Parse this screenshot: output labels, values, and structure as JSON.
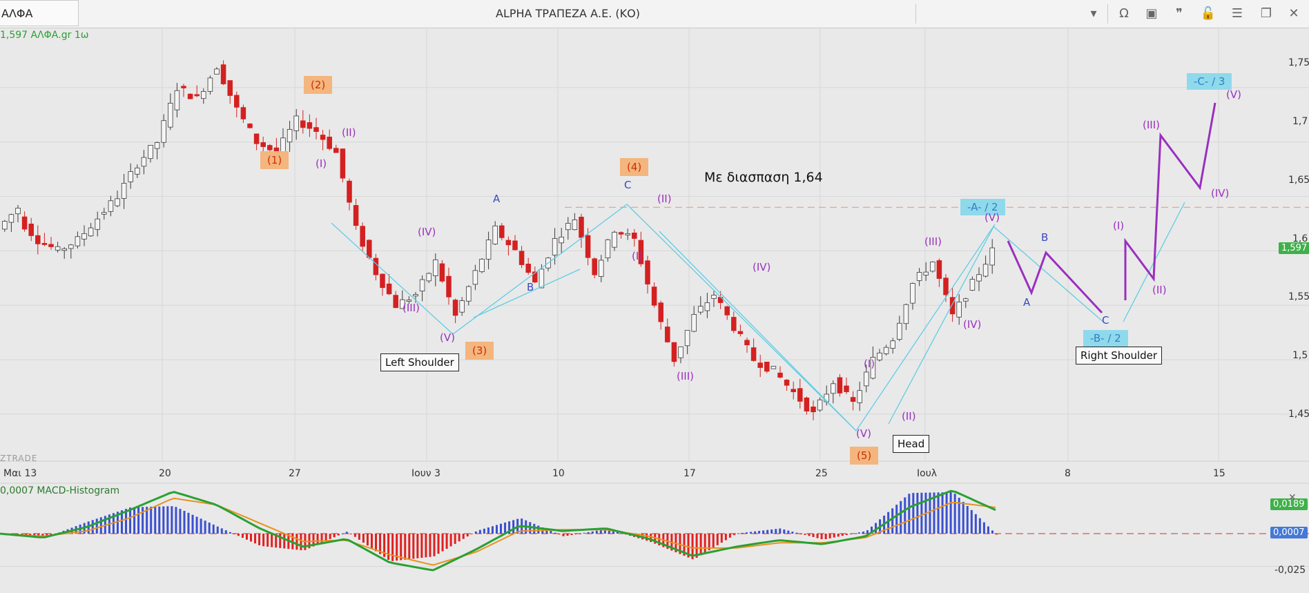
{
  "window": {
    "symbol": "ΑΛΦΑ",
    "title": "ALPHA ΤΡΑΠΕΖΑ Α.Ε. (ΚΟ)",
    "icons": [
      "chevron-down-icon",
      "omega-icon",
      "panel-icon",
      "comment-icon",
      "unlock-icon",
      "menu-icon",
      "restore-icon",
      "close-icon"
    ],
    "icon_glyphs": [
      "▾",
      "Ω",
      "▣",
      "❞",
      "🔓",
      "☰",
      "❐",
      "✕"
    ]
  },
  "price_info": "1,597 ΑΛΦΑ.gr 1ω",
  "watermark": "ZTRADE",
  "macd_info": "0,0007 MACD-Histogram",
  "annotation_title": "Με διασπαση 1,64",
  "labels": {
    "left_shoulder": "Left Shoulder",
    "head": "Head",
    "right_shoulder": "Right Shoulder",
    "w1": "(1)",
    "w2": "(2)",
    "w3": "(3)",
    "w4": "(4)",
    "w5": "(5)",
    "a2": "-A- / 2",
    "b2": "-B- / 2",
    "c3": "-C- / 3",
    "A": "A",
    "B": "B",
    "C": "C",
    "I": "(I)",
    "II": "(II)",
    "III": "(III)",
    "IV": "(IV)",
    "V": "(V)"
  },
  "colors": {
    "up": "#3a3a3a",
    "down": "#d42020",
    "green": "#2aa033",
    "purple": "#9a2fbf",
    "cyan": "#5fcde4",
    "orange": "#e8921c",
    "macd_pos": "#3a4fd0",
    "macd_neg": "#e02020"
  },
  "current_price": "1,597",
  "macd_values": {
    "line": "0,0189",
    "hist": "0,0007"
  },
  "chart_data": [
    {
      "type": "candlestick",
      "title": "ALPHA ΤΡΑΠΕΖΑ Α.Ε. (ΚΟ)",
      "y_ticks": [
        "1,75",
        "1,7",
        "1,65",
        "1,6",
        "1,55",
        "1,5",
        "1,45"
      ],
      "y_tick_values": [
        1.75,
        1.7,
        1.65,
        1.6,
        1.55,
        1.5,
        1.45
      ],
      "x_ticks": [
        "Μαι 13",
        "20",
        "27",
        "Ιουν 3",
        "10",
        "17",
        "25",
        "Ιουλ",
        "8",
        "15"
      ],
      "ylim": [
        1.41,
        1.8
      ],
      "resistance": 1.64,
      "close_path": [
        [
          1.62,
          1.64
        ],
        [
          1.63,
          1.61
        ],
        [
          1.61,
          1.6
        ],
        [
          1.6,
          1.61
        ],
        [
          1.61,
          1.63
        ],
        [
          1.63,
          1.65
        ],
        [
          1.65,
          1.68
        ],
        [
          1.68,
          1.7
        ],
        [
          1.7,
          1.75
        ],
        [
          1.75,
          1.74
        ],
        [
          1.74,
          1.77
        ],
        [
          1.77,
          1.73
        ],
        [
          1.73,
          1.7
        ],
        [
          1.7,
          1.69
        ],
        [
          1.69,
          1.72
        ],
        [
          1.72,
          1.71
        ],
        [
          1.71,
          1.69
        ],
        [
          1.69,
          1.62
        ],
        [
          1.62,
          1.58
        ],
        [
          1.58,
          1.55
        ],
        [
          1.55,
          1.56
        ],
        [
          1.56,
          1.59
        ],
        [
          1.59,
          1.54
        ],
        [
          1.54,
          1.58
        ],
        [
          1.58,
          1.62
        ],
        [
          1.62,
          1.6
        ],
        [
          1.6,
          1.57
        ],
        [
          1.57,
          1.61
        ],
        [
          1.61,
          1.63
        ],
        [
          1.63,
          1.58
        ],
        [
          1.58,
          1.62
        ],
        [
          1.62,
          1.61
        ],
        [
          1.61,
          1.55
        ],
        [
          1.55,
          1.5
        ],
        [
          1.5,
          1.54
        ],
        [
          1.54,
          1.56
        ],
        [
          1.56,
          1.53
        ],
        [
          1.53,
          1.5
        ],
        [
          1.5,
          1.49
        ],
        [
          1.49,
          1.47
        ],
        [
          1.47,
          1.45
        ],
        [
          1.45,
          1.48
        ],
        [
          1.48,
          1.46
        ],
        [
          1.46,
          1.5
        ],
        [
          1.5,
          1.52
        ],
        [
          1.52,
          1.57
        ],
        [
          1.57,
          1.59
        ],
        [
          1.59,
          1.54
        ],
        [
          1.54,
          1.57
        ],
        [
          1.57,
          1.6
        ]
      ],
      "projection": {
        "points": [
          [
            1.6,
            1.55
          ],
          [
            1.55,
            1.59
          ],
          [
            1.59,
            1.53
          ],
          [
            1.53,
            1.6
          ],
          [
            1.6,
            1.57
          ],
          [
            1.57,
            1.69
          ],
          [
            1.69,
            1.65
          ],
          [
            1.65,
            1.72
          ]
        ]
      }
    },
    {
      "type": "line",
      "title": "MACD-Histogram",
      "y_ticks": [
        "0,0189",
        "0,0007",
        "-0,025"
      ],
      "series": [
        {
          "name": "MACD",
          "values": [
            0.0,
            -0.003,
            0.005,
            0.018,
            0.032,
            0.022,
            0.004,
            -0.01,
            -0.004,
            -0.022,
            -0.028,
            -0.012,
            0.006,
            0.002,
            0.004,
            -0.004,
            -0.017,
            -0.01,
            -0.005,
            -0.008,
            -0.002,
            0.02,
            0.033,
            0.018
          ]
        },
        {
          "name": "Signal",
          "values": [
            0.0,
            -0.002,
            0.002,
            0.012,
            0.027,
            0.022,
            0.008,
            -0.006,
            -0.005,
            -0.016,
            -0.024,
            -0.014,
            0.002,
            0.003,
            0.003,
            -0.002,
            -0.011,
            -0.011,
            -0.007,
            -0.007,
            -0.003,
            0.01,
            0.024,
            0.02
          ]
        }
      ]
    }
  ]
}
